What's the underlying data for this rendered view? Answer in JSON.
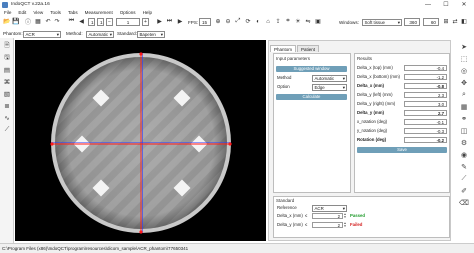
{
  "window": {
    "title": "IndoQCT v.22a.16",
    "minimize": "—",
    "maximize": "☐",
    "close": "✕"
  },
  "menu": [
    "File",
    "Edit",
    "View",
    "Tools",
    "Tabs",
    "Measurement",
    "Options",
    "Help"
  ],
  "toolbar": {
    "page_current": "1",
    "page_total": "1",
    "fps_label": "FPS:",
    "fps_value": "15",
    "windows_label": "Windows:",
    "windows_value": "Soft tissue",
    "window_level": "360",
    "window_width": "60"
  },
  "options_bar": {
    "phantom_label": "Phantom:",
    "phantom_value": "ACR",
    "method_label": "Method:",
    "method_value": "Automatic",
    "standard_label": "Standard:",
    "standard_value": "Bapeten"
  },
  "panel": {
    "tabs": [
      "Phantom",
      "Patient"
    ],
    "input_title": "Input parameters",
    "suggest_button": "Suggested window",
    "method_label": "Method",
    "method_value": "Automatic",
    "option_label": "Option",
    "option_value": "Edge",
    "calculate_button": "Calculate",
    "results_title": "Results",
    "results": [
      {
        "label": "Delta_x (top) (mm)",
        "value": "-0.4",
        "bold": false
      },
      {
        "label": "Delta_x (bottom) (mm)",
        "value": "-1.2",
        "bold": false
      },
      {
        "label": "Delta_x (mm)",
        "value": "-0.8",
        "bold": true
      },
      {
        "label": "Delta_y (left) (mm)",
        "value": "2.3",
        "bold": false
      },
      {
        "label": "Delta_y (right) (mm)",
        "value": "3.0",
        "bold": false
      },
      {
        "label": "Delta_y (mm)",
        "value": "2.7",
        "bold": true
      },
      {
        "label": "x_rotation (deg)",
        "value": "-0.1",
        "bold": false
      },
      {
        "label": "y_rotation (deg)",
        "value": "-0.3",
        "bold": false
      },
      {
        "label": "Rotation (deg)",
        "value": "-0.2",
        "bold": true
      }
    ],
    "save_button": "Save",
    "standard_title": "Standard",
    "reference_label": "Reference",
    "reference_value": "ACR",
    "dx_label": "Delta_x (mm)",
    "dx_op": "≤",
    "dx_value": "2",
    "dx_status": "Passed",
    "dy_label": "Delta_y (mm)",
    "dy_op": "≤",
    "dy_value": "2",
    "dy_status": "Failed"
  },
  "status_bar": {
    "path": "C:\\Program Files (x86)\\IndoQCT\\program\\resources\\dicom_sample\\ACR_phantom\\77650341"
  },
  "colors": {
    "accent_button": "#6f9fb8",
    "passed": "#1e9a2a",
    "failed": "#d42020",
    "crosshair_red": "#ff1a1a",
    "crosshair_blue": "#2a3cff"
  },
  "icons": {
    "left_tools": [
      "open-file-icon",
      "save-icon",
      "folder-icon",
      "tag-icon",
      "image-icon",
      "stack-icon",
      "profile-icon",
      "chart-icon"
    ],
    "right_tools": [
      "arrow-icon",
      "measure-icon",
      "circle-roi-icon",
      "pan-icon",
      "zoom-icon",
      "grid-icon",
      "link-icon",
      "layers-icon",
      "settings-icon",
      "eye-icon",
      "annotate-icon",
      "ruler-icon",
      "pen-icon",
      "eraser-icon"
    ]
  }
}
